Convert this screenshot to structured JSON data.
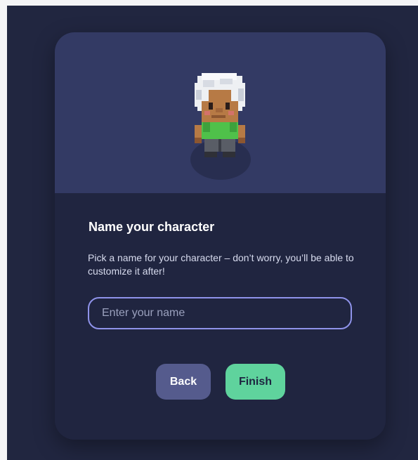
{
  "dialog": {
    "title": "Name your character",
    "description": "Pick a name for your character – don’t worry, you’ll be able to customize it after!",
    "name_input": {
      "placeholder": "Enter your name",
      "value": ""
    },
    "buttons": {
      "back_label": "Back",
      "finish_label": "Finish"
    }
  },
  "colors": {
    "page_background": "#212640",
    "card_background": "#202540",
    "hero_background": "#333a64",
    "input_border": "#8f93ea",
    "back_button": "#555b8d",
    "finish_button": "#5fd39d"
  },
  "icons": {
    "avatar": "pixel-character-avatar"
  }
}
